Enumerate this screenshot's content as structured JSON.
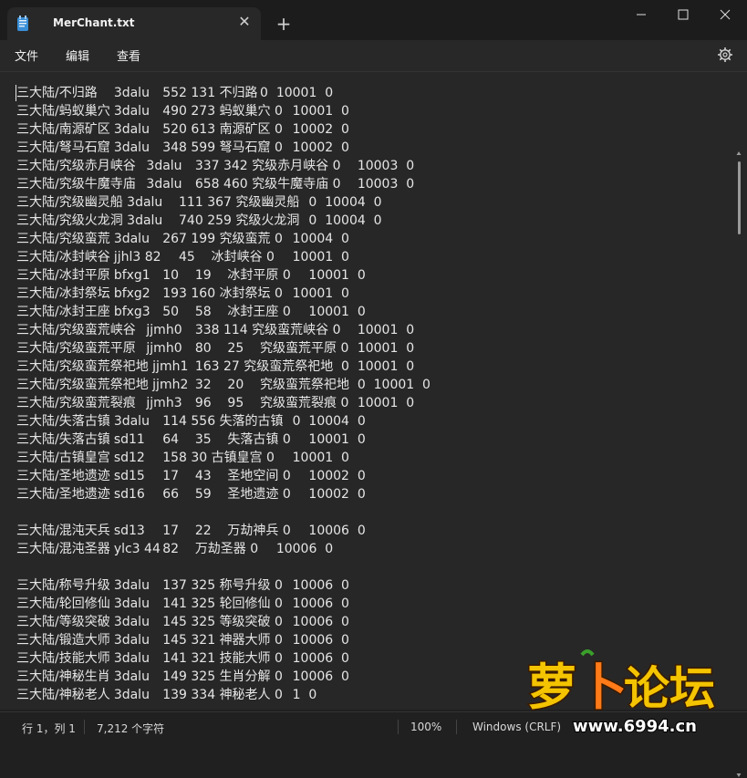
{
  "window": {
    "tab_title": "MerChant.txt",
    "tab_icon": "notepad-icon",
    "close_tab_glyph": "✕",
    "new_tab_glyph": "+"
  },
  "menu": {
    "file": "文件",
    "edit": "编辑",
    "view": "查看"
  },
  "editor": {
    "lines": [
      "三大陆/不归路\t3dalu\t552 131 不归路\t0\t10001\t0",
      "三大陆/蚂蚁巢穴\t3dalu\t490 273 蚂蚁巢穴 0\t10001\t0",
      "三大陆/南源矿区\t3dalu\t520 613 南源矿区 0\t10002\t0",
      "三大陆/弩马石窟\t3dalu\t348 599 弩马石窟 0\t10002\t0",
      "三大陆/究级赤月峡谷\t3dalu\t337 342 究级赤月峡谷 0\t10003\t0",
      "三大陆/究级牛魔寺庙\t3dalu\t658 460 究级牛魔寺庙 0\t10003\t0",
      "三大陆/究级幽灵船 3dalu\t111 367 究级幽灵船\t0\t10004\t0",
      "三大陆/究级火龙洞 3dalu\t740 259 究级火龙洞\t0\t10004\t0",
      "三大陆/究级蛮荒\t3dalu\t267 199 究级蛮荒 0\t10004\t0",
      "三大陆/冰封峡谷\tjjhl3 82\t45\t冰封峡谷 0\t10001\t0",
      "三大陆/冰封平原\tbfxg1\t10\t19\t冰封平原 0\t10001\t0",
      "三大陆/冰封祭坛\tbfxg2\t193 160 冰封祭坛 0\t10001\t0",
      "三大陆/冰封王座\tbfxg3\t50\t58\t冰封王座 0\t10001\t0",
      "三大陆/究级蛮荒峡谷\tjjmh0\t338 114 究级蛮荒峡谷 0\t10001\t0",
      "三大陆/究级蛮荒平原\tjjmh0\t80\t25\t究级蛮荒平原 0\t10001\t0",
      "三大陆/究级蛮荒祭祀地 jjmh1\t163 27\t究级蛮荒祭祀地\t0\t10001\t0",
      "三大陆/究级蛮荒祭祀地 jjmh2\t32\t20\t究级蛮荒祭祀地\t0\t10001\t0",
      "三大陆/究级蛮荒裂痕\tjjmh3\t96\t95\t究级蛮荒裂痕 0\t10001\t0",
      "三大陆/失落古镇\t3dalu\t114 556 失落的古镇\t0\t10004\t0",
      "三大陆/失落古镇\tsd11\t64\t35\t失落古镇 0\t10001\t0",
      "三大陆/古镇皇宫\tsd12\t158 30\t古镇皇宫 0\t10001\t0",
      "三大陆/圣地遗迹\tsd15\t17\t43\t圣地空间 0\t10002\t0",
      "三大陆/圣地遗迹\tsd16\t66\t59\t圣地遗迹 0\t10002\t0",
      "",
      "三大陆/混沌天兵\tsd13\t17\t22\t万劫神兵 0\t10006\t0",
      "三大陆/混沌圣器\tylc3 44\t82\t万劫圣器 0\t10006\t0",
      "",
      "三大陆/称号升级\t3dalu\t137 325 称号升级 0\t10006\t0",
      "三大陆/轮回修仙\t3dalu\t141 325 轮回修仙 0\t10006\t0",
      "三大陆/等级突破\t3dalu\t145 325 等级突破 0\t10006\t0",
      "三大陆/锻造大师\t3dalu\t145 321 神器大师 0\t10006\t0",
      "三大陆/技能大师\t3dalu\t141 321 技能大师 0\t10006\t0",
      "三大陆/神秘生肖\t3dalu\t149 325 生肖分解 0\t10006\t0",
      "三大陆/神秘老人\t3dalu\t139 334 神秘老人 0\t1\t0"
    ]
  },
  "status": {
    "position": "行 1，列 1",
    "chars": "7,212 个字符",
    "zoom": "100%",
    "line_ending": "Windows (CRLF)"
  },
  "colors": {
    "background": "#272727",
    "text": "#e6e6e6",
    "titlebar": "#1c1c1c"
  }
}
